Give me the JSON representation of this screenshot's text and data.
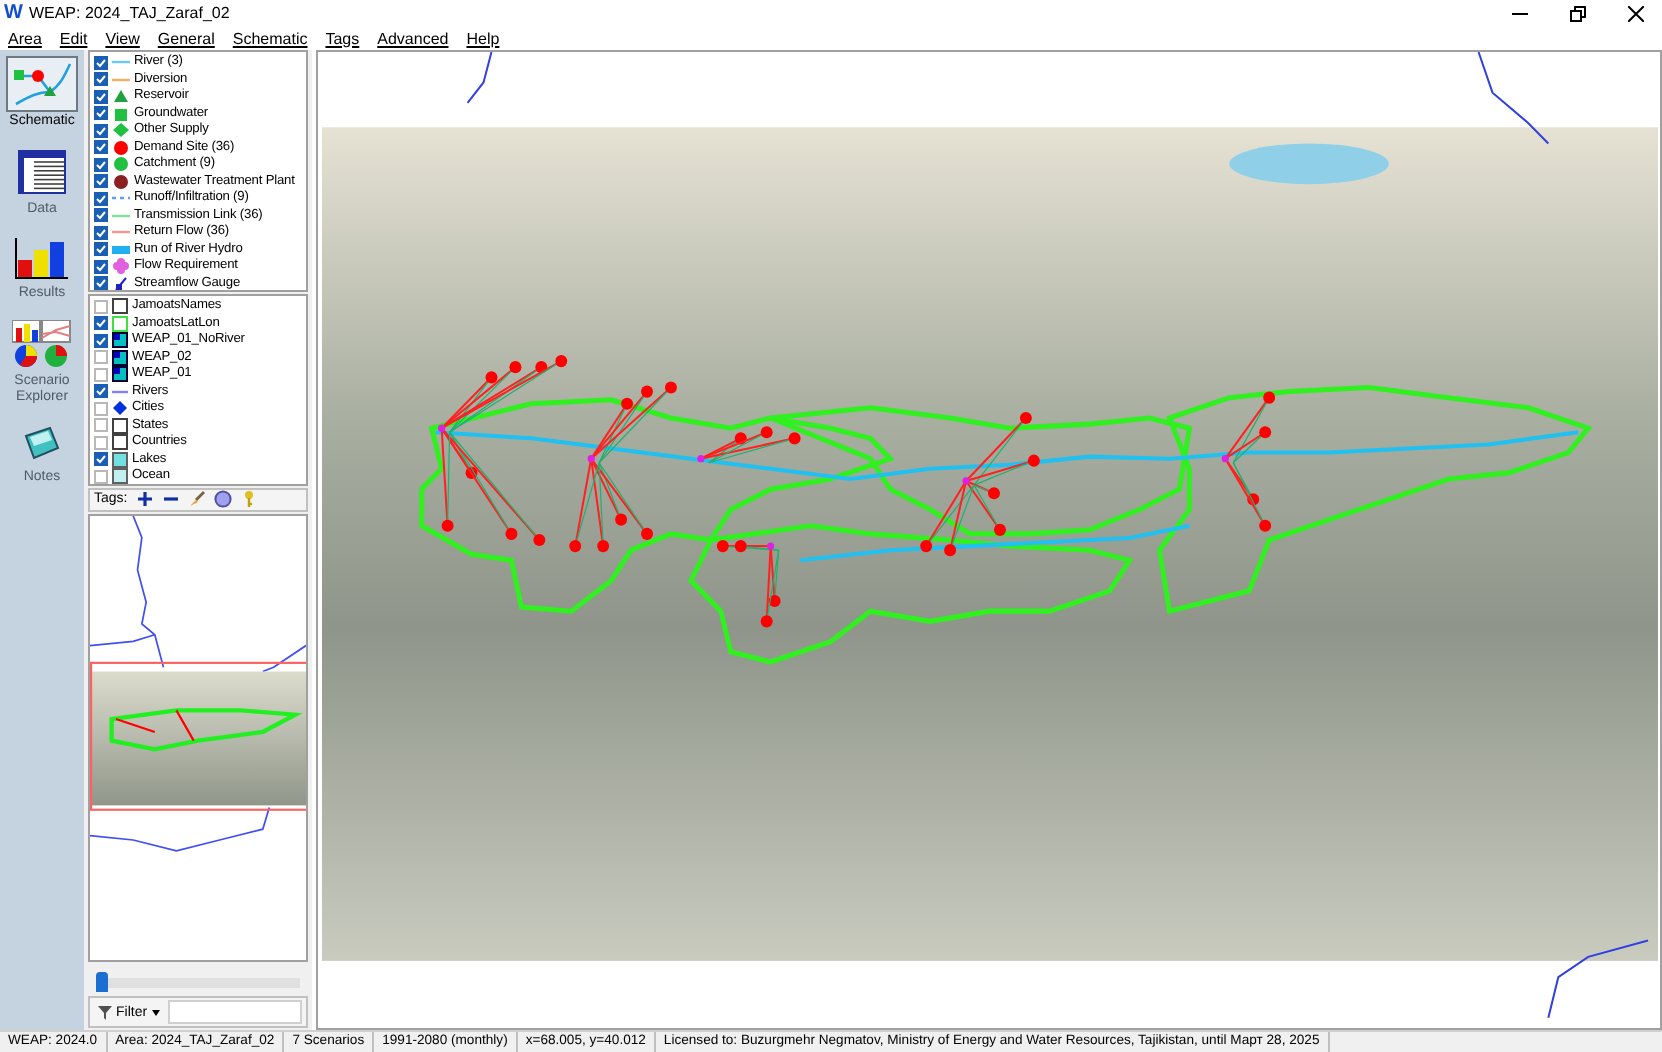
{
  "window": {
    "logo": "W",
    "title": "WEAP: 2024_TAJ_Zaraf_02"
  },
  "menu": [
    "Area",
    "Edit",
    "View",
    "General",
    "Schematic",
    "Tags",
    "Advanced",
    "Help"
  ],
  "views": [
    {
      "label": "Schematic",
      "kind": "schematic",
      "selected": true
    },
    {
      "label": "Data",
      "kind": "data",
      "selected": false
    },
    {
      "label": "Results",
      "kind": "results",
      "selected": false
    },
    {
      "label": "Scenario Explorer",
      "kind": "explorer",
      "selected": false
    },
    {
      "label": "Notes",
      "kind": "notes",
      "selected": false
    }
  ],
  "legend": [
    {
      "label": "River (3)",
      "checked": true,
      "kind": "line",
      "color": "#6cc8f0"
    },
    {
      "label": "Diversion",
      "checked": true,
      "kind": "line",
      "color": "#f0b060"
    },
    {
      "label": "Reservoir",
      "checked": true,
      "kind": "triangle",
      "color": "#20a040"
    },
    {
      "label": "Groundwater",
      "checked": true,
      "kind": "square",
      "color": "#20c040"
    },
    {
      "label": "Other Supply",
      "checked": true,
      "kind": "diamond",
      "color": "#20c040"
    },
    {
      "label": "Demand Site (36)",
      "checked": true,
      "kind": "circle",
      "color": "#ff0000"
    },
    {
      "label": "Catchment (9)",
      "checked": true,
      "kind": "circle",
      "color": "#20c040"
    },
    {
      "label": "Wastewater Treatment Plant",
      "checked": true,
      "kind": "circle",
      "color": "#8b2020"
    },
    {
      "label": "Runoff/Infiltration (9)",
      "checked": true,
      "kind": "dashed",
      "color": "#60a0f0"
    },
    {
      "label": "Transmission Link (36)",
      "checked": true,
      "kind": "line",
      "color": "#80e0a0"
    },
    {
      "label": "Return Flow (36)",
      "checked": true,
      "kind": "line",
      "color": "#ff9090"
    },
    {
      "label": "Run of River Hydro",
      "checked": true,
      "kind": "bar",
      "color": "#20b0f0"
    },
    {
      "label": "Flow Requirement",
      "checked": true,
      "kind": "flower",
      "color": "#e060e0"
    },
    {
      "label": "Streamflow Gauge",
      "checked": true,
      "kind": "gauge",
      "color": "#2020c0"
    }
  ],
  "layers": [
    {
      "label": "JamoatsNames",
      "checked": false,
      "kind": "box",
      "color": "#404040"
    },
    {
      "label": "JamoatsLatLon",
      "checked": true,
      "kind": "box",
      "color": "#40e040"
    },
    {
      "label": "WEAP_01_NoRiver",
      "checked": true,
      "kind": "raster",
      "color": "#00c0c0"
    },
    {
      "label": "WEAP_02",
      "checked": false,
      "kind": "raster",
      "color": "#00c0c0"
    },
    {
      "label": "WEAP_01",
      "checked": false,
      "kind": "raster",
      "color": "#00c0c0"
    },
    {
      "label": "Rivers",
      "checked": true,
      "kind": "line",
      "color": "#8080ff"
    },
    {
      "label": "Cities",
      "checked": false,
      "kind": "point",
      "color": "#0030e0"
    },
    {
      "label": "States",
      "checked": false,
      "kind": "box",
      "color": "#404040"
    },
    {
      "label": "Countries",
      "checked": false,
      "kind": "box",
      "color": "#404040"
    },
    {
      "label": "Lakes",
      "checked": true,
      "kind": "fill",
      "color": "#70e0e0"
    },
    {
      "label": "Ocean",
      "checked": false,
      "kind": "fill",
      "color": "#c0f0f0"
    }
  ],
  "tags_toolbar": {
    "label": "Tags:"
  },
  "overview_slider": {
    "level": 0.0
  },
  "filter": {
    "label": "Filter"
  },
  "status_bar": [
    "WEAP: 2024.0",
    "Area: 2024_TAJ_Zaraf_02",
    "7 Scenarios",
    "1991-2080 (monthly)",
    "x=68.005, y=40.012",
    "Licensed to: Buzurgmehr Negmatov, Ministry of Energy and Water Resources, Tajikistan, until Март 28, 2025"
  ]
}
